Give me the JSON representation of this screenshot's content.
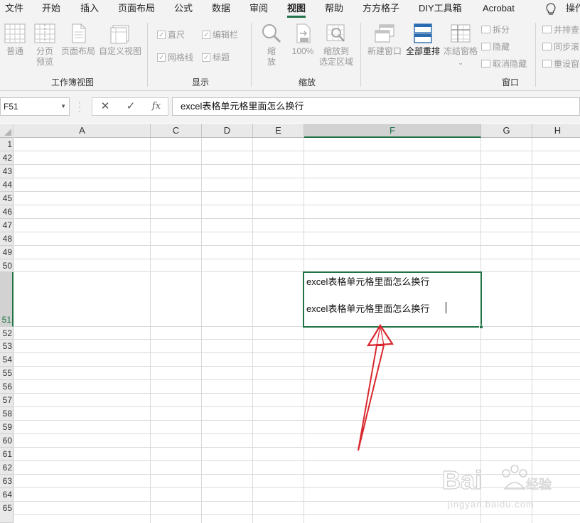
{
  "tabs": [
    {
      "label": "文件"
    },
    {
      "label": "开始"
    },
    {
      "label": "插入"
    },
    {
      "label": "页面布局"
    },
    {
      "label": "公式"
    },
    {
      "label": "数据"
    },
    {
      "label": "审阅"
    },
    {
      "label": "视图",
      "active": true
    },
    {
      "label": "帮助"
    },
    {
      "label": "方方格子"
    },
    {
      "label": "DIY工具箱"
    },
    {
      "label": "Acrobat"
    }
  ],
  "tell_me": "操作",
  "ribbon": {
    "views": {
      "label": "工作簿视图",
      "normal": "普通",
      "page_break_1": "分页",
      "page_break_2": "预览",
      "page_layout": "页面布局",
      "custom_views": "自定义视图"
    },
    "show": {
      "label": "显示",
      "ruler": "直尺",
      "formula_bar": "编辑栏",
      "gridlines": "网格线",
      "headings": "标题"
    },
    "zoom": {
      "label": "缩放",
      "zoom_1": "缩",
      "zoom_2": "放",
      "zoom_100": "100%",
      "zoom_sel_1": "缩放到",
      "zoom_sel_2": "选定区域"
    },
    "window": {
      "label": "窗口",
      "new_window": "新建窗口",
      "arrange_all": "全部重排",
      "freeze_panes": "冻结窗格",
      "split": "拆分",
      "hide": "隐藏",
      "unhide": "取消隐藏",
      "side_by_side": "并排查",
      "sync_scroll": "同步滚",
      "reset_pos": "重设窗"
    }
  },
  "formula_bar": {
    "name_box": "F51",
    "cancel": "✕",
    "enter": "✓",
    "fx": "fx",
    "content": "excel表格单元格里面怎么换行"
  },
  "sheet": {
    "columns": [
      "A",
      "C",
      "D",
      "E",
      "F",
      "G",
      "H"
    ],
    "rows": [
      "1",
      "42",
      "43",
      "44",
      "45",
      "46",
      "47",
      "48",
      "49",
      "50",
      "51",
      "52",
      "53",
      "54",
      "55",
      "56",
      "57",
      "58",
      "59",
      "60",
      "61",
      "62",
      "63",
      "64",
      "65"
    ],
    "selected_column": "F",
    "selected_row": "51",
    "active_cell_line1": "excel表格单元格里面怎么换行",
    "active_cell_line2": "excel表格单元格里面怎么换行"
  },
  "watermark": {
    "brand": "Bai",
    "brand_cn": "经验",
    "url": "jingyan.baidu.com"
  },
  "colors": {
    "accent": "#217346",
    "annotation": "#d9272e",
    "ribbon_bg": "#f3f3f3"
  }
}
